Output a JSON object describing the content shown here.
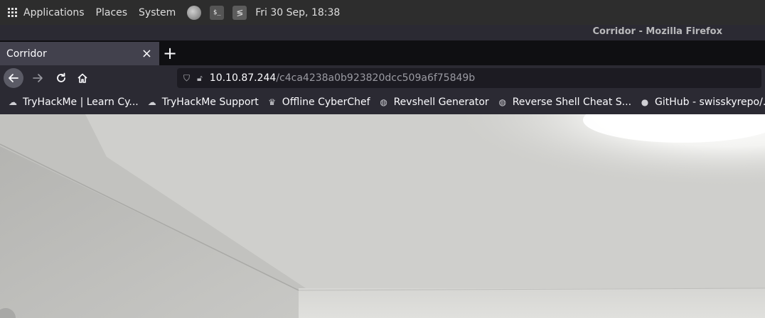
{
  "system_bar": {
    "menus": [
      "Applications",
      "Places",
      "System"
    ],
    "clock": "Fri 30 Sep, 18:38"
  },
  "window": {
    "title": "Corridor - Mozilla Firefox"
  },
  "tabs": [
    {
      "title": "Corridor",
      "close_icon": "×"
    }
  ],
  "new_tab_label": "+",
  "url": {
    "host": "10.10.87.244",
    "path": "/c4ca4238a0b923820dcc509a6f75849b"
  },
  "bookmarks": [
    {
      "label": "TryHackMe | Learn Cy...",
      "icon": "cloud-icon"
    },
    {
      "label": "TryHackMe Support",
      "icon": "cloud-icon"
    },
    {
      "label": "Offline CyberChef",
      "icon": "chef-hat-icon"
    },
    {
      "label": "Revshell Generator",
      "icon": "globe-icon"
    },
    {
      "label": "Reverse Shell Cheat S...",
      "icon": "globe-icon"
    },
    {
      "label": "GitHub - swisskyrepo/...",
      "icon": "github-icon"
    }
  ]
}
